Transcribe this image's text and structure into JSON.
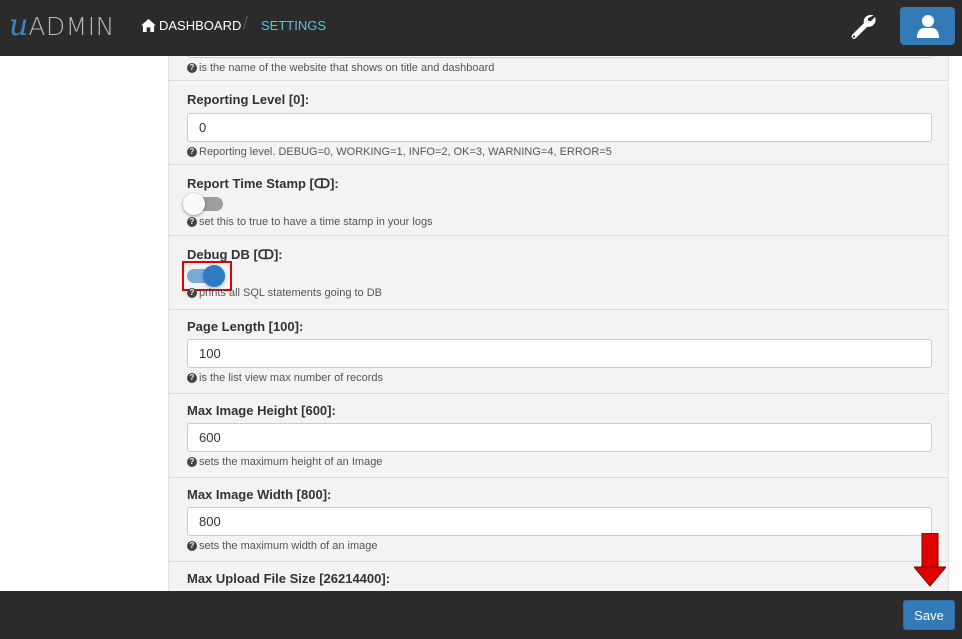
{
  "header": {
    "logo_u": "u",
    "logo_text": "ADMIN",
    "breadcrumb": {
      "home_label": "DASHBOARD",
      "separator": "/",
      "current_label": "SETTINGS"
    }
  },
  "settings": {
    "partial_help": "is the name of the website that shows on title and dashboard",
    "reporting_level": {
      "label": "Reporting Level [0]:",
      "value": "0",
      "help": "Reporting level. DEBUG=0, WORKING=1, INFO=2, OK=3, WARNING=4, ERROR=5"
    },
    "report_time_stamp": {
      "label": "Report Time Stamp [ↀ]:",
      "enabled": false,
      "help": "set this to true to have a time stamp in your logs"
    },
    "debug_db": {
      "label": "Debug DB [ↀ]:",
      "enabled": true,
      "help": "prints all SQL statements going to DB"
    },
    "page_length": {
      "label": "Page Length [100]:",
      "value": "100",
      "help": "is the list view max number of records"
    },
    "max_image_height": {
      "label": "Max Image Height [600]:",
      "value": "600",
      "help": "sets the maximum height of an Image"
    },
    "max_image_width": {
      "label": "Max Image Width [800]:",
      "value": "800",
      "help": "sets the maximum width of an image"
    },
    "max_upload_file_size": {
      "label": "Max Upload File Size [26214400]:"
    }
  },
  "footer": {
    "save_label": "Save"
  },
  "colors": {
    "accent": "#337ab7",
    "navbar": "#2b2b2b",
    "link": "#5bc0de",
    "highlight": "#e00000"
  }
}
